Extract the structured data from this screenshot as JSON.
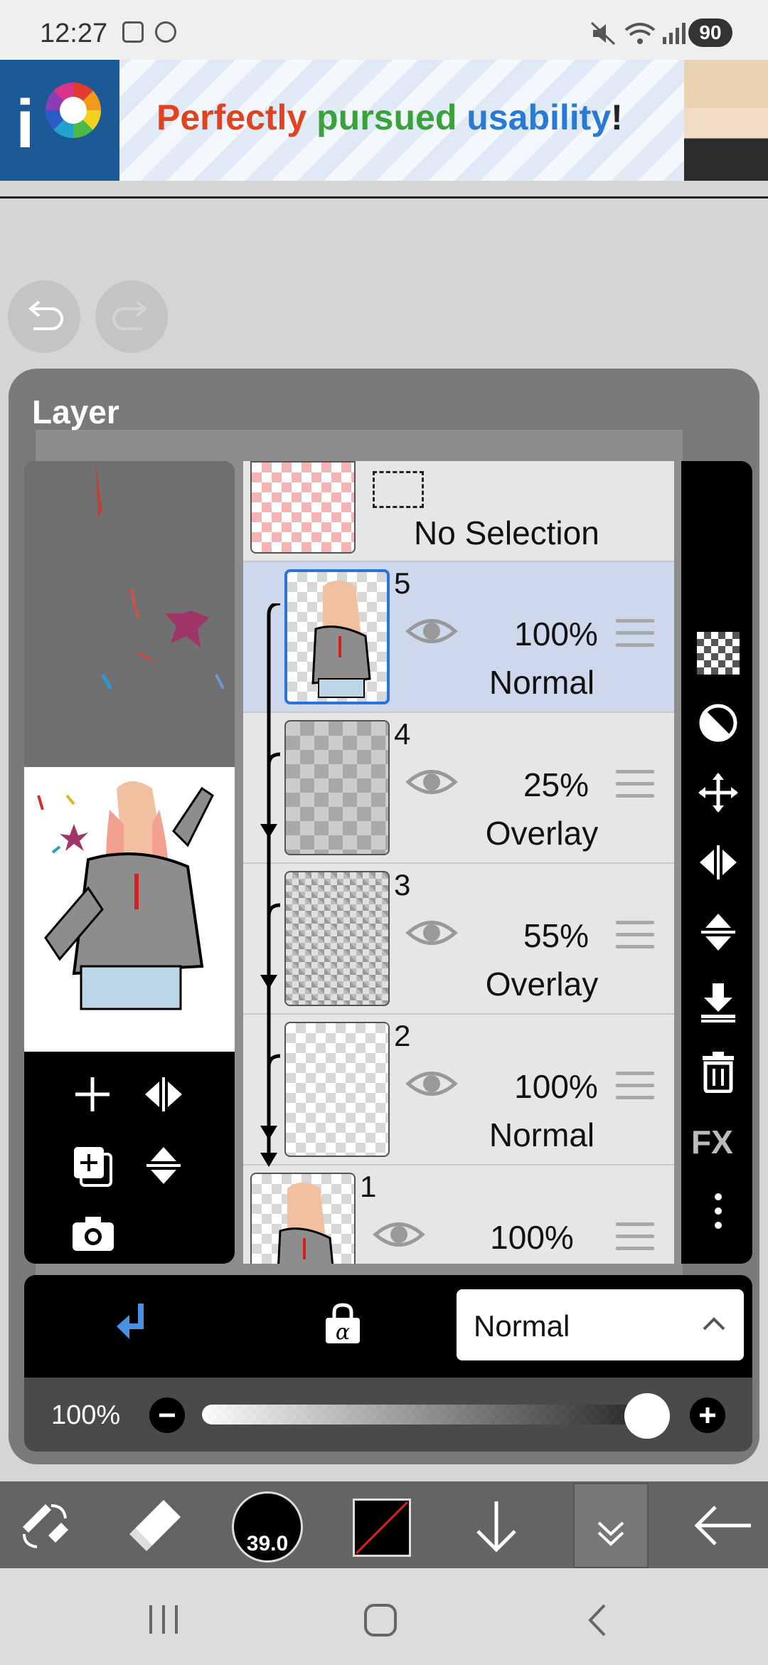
{
  "status_bar": {
    "time": "12:27",
    "battery": "90",
    "icons": [
      "screenshot-icon",
      "ibispaint-notification-icon",
      "mute-icon",
      "wifi-icon",
      "signal-icon"
    ]
  },
  "ad_banner": {
    "word1": "Perfectly",
    "word2": "pursued",
    "word3": "usability",
    "word4": "!",
    "colors": {
      "red": "#e0431f",
      "green": "#3aa23a",
      "blue": "#2a7ad4"
    }
  },
  "layer_panel": {
    "title": "Layer",
    "selection_row": {
      "label": "No Selection"
    },
    "layers": [
      {
        "number": "5",
        "opacity": "100%",
        "mode": "Normal",
        "selected": true
      },
      {
        "number": "4",
        "opacity": "25%",
        "mode": "Overlay",
        "selected": false
      },
      {
        "number": "3",
        "opacity": "55%",
        "mode": "Overlay",
        "selected": false
      },
      {
        "number": "2",
        "opacity": "100%",
        "mode": "Normal",
        "selected": false
      },
      {
        "number": "1",
        "opacity": "100%",
        "mode": "",
        "selected": false
      }
    ],
    "right_tools": [
      "checkerboard-icon",
      "half-circle-icon",
      "move-icon",
      "flip-horizontal-icon",
      "flip-vertical-icon",
      "merge-down-icon",
      "trash-icon",
      "FX",
      "more-icon"
    ],
    "left_tools": [
      "add-layer-icon",
      "flip-horizontal-icon",
      "duplicate-layer-icon",
      "flip-vertical-icon",
      "camera-icon"
    ],
    "fx_label": "FX",
    "blend_mode": "Normal",
    "opacity_label": "100%",
    "opacity_value": 1.0,
    "accent_color": "#2a73d9"
  },
  "toolbar": {
    "brush_size": "39.0",
    "icons": [
      "transform-tool-icon",
      "eraser-icon",
      "brush-size-icon",
      "color-swatch-icon",
      "down-arrow-icon",
      "expand-icon",
      "back-arrow-icon"
    ]
  }
}
